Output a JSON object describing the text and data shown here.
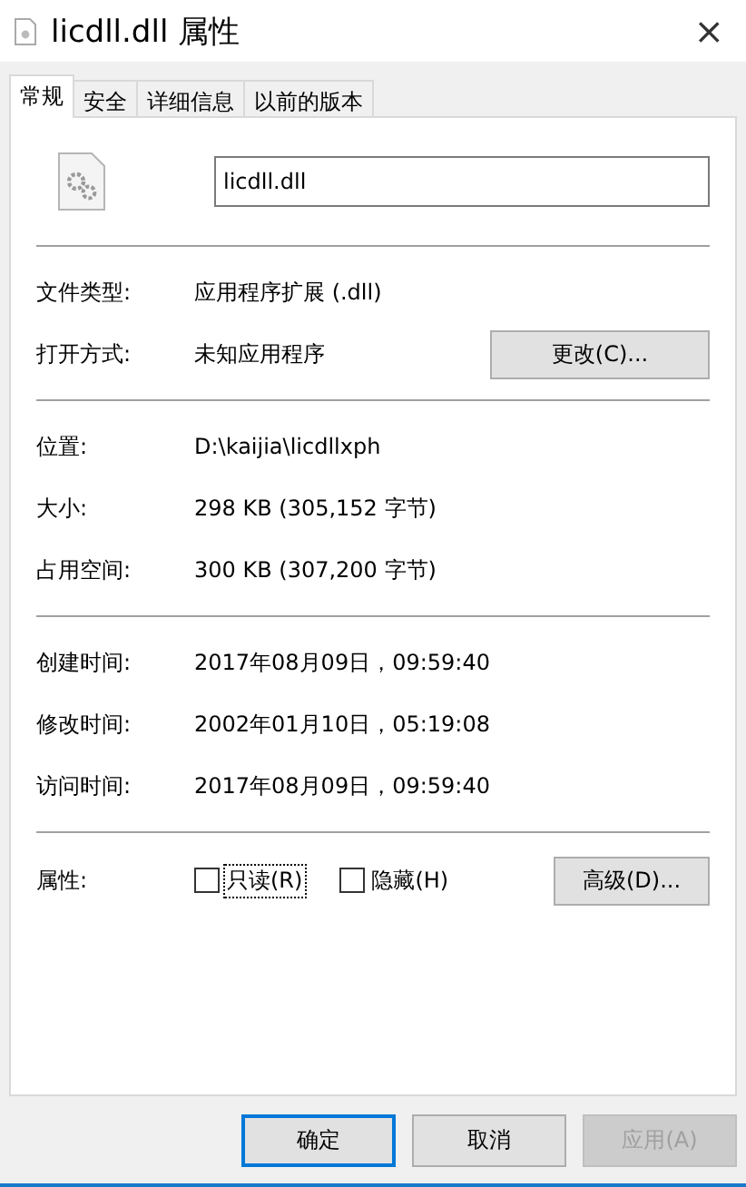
{
  "window": {
    "title": "licdll.dll 属性",
    "close": "×"
  },
  "tabs": [
    {
      "label": "常规",
      "selected": true
    },
    {
      "label": "安全",
      "selected": false
    },
    {
      "label": "详细信息",
      "selected": false
    },
    {
      "label": "以前的版本",
      "selected": false
    }
  ],
  "file_name": "licdll.dll",
  "sections": [
    [
      {
        "label": "文件类型:",
        "value": "应用程序扩展 (.dll)"
      },
      {
        "label": "打开方式:",
        "value": "未知应用程序",
        "button": "更改(C)..."
      }
    ],
    [
      {
        "label": "位置:",
        "value": "D:\\kaijia\\licdllxph"
      },
      {
        "label": "大小:",
        "value": "298 KB (305,152 字节)"
      },
      {
        "label": "占用空间:",
        "value": "300 KB (307,200 字节)"
      }
    ],
    [
      {
        "label": "创建时间:",
        "value": "2017年08月09日，09:59:40"
      },
      {
        "label": "修改时间:",
        "value": "2002年01月10日，05:19:08"
      },
      {
        "label": "访问时间:",
        "value": "2017年08月09日，09:59:40"
      }
    ]
  ],
  "attributes": {
    "label": "属性:",
    "checkboxes": [
      {
        "label": "只读(R)",
        "checked": false,
        "focused": true
      },
      {
        "label": "隐藏(H)",
        "checked": false,
        "focused": false
      }
    ],
    "button": "高级(D)..."
  },
  "buttons": [
    {
      "label": "确定",
      "default": true,
      "disabled": false
    },
    {
      "label": "取消",
      "default": false,
      "disabled": false
    },
    {
      "label": "应用(A)",
      "default": false,
      "disabled": true
    }
  ]
}
